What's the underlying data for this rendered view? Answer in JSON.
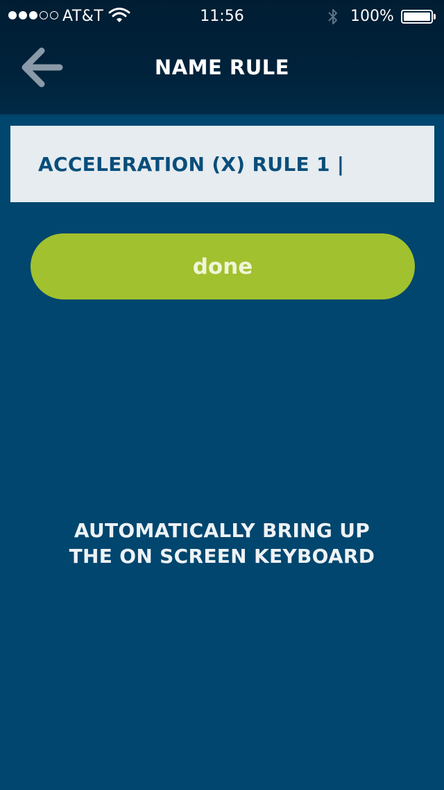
{
  "status_bar": {
    "signal_filled": 3,
    "signal_total": 5,
    "carrier": "AT&T",
    "time": "11:56",
    "battery": "100%",
    "icons": [
      "wifi-icon",
      "bluetooth-icon",
      "battery-icon"
    ]
  },
  "nav": {
    "title": "NAME RULE",
    "back_icon": "arrow-left-icon"
  },
  "name_input": {
    "value": "ACCELERATION (X) RULE 1 |"
  },
  "done_button": {
    "label": "done"
  },
  "note": {
    "line1": "AUTOMATICALLY BRING UP",
    "line2": "THE ON SCREEN KEYBOARD"
  },
  "colors": {
    "background": "#00466e",
    "header": "#001d33",
    "field_background": "#e6ecf0",
    "field_text": "#0a4e7a",
    "accent_green": "#a1c12f",
    "back_arrow": "#8a9aa8"
  }
}
